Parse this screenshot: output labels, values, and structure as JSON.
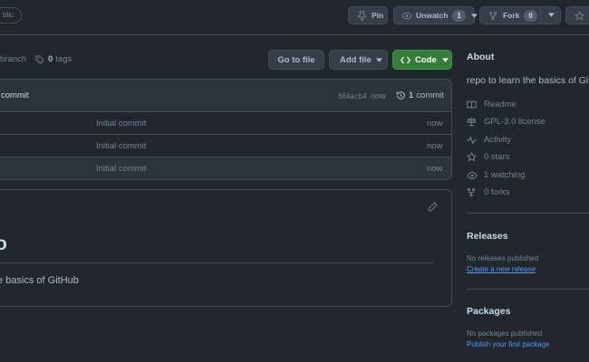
{
  "header": {
    "visibility_badge": "blic",
    "pin_label": "Pin",
    "unwatch_label": "Unwatch",
    "unwatch_count": "1",
    "fork_label": "Fork",
    "fork_count": "0"
  },
  "repo_nav": {
    "branch_label": "branch",
    "tags_count": "0",
    "tags_label": "tags",
    "goto_file_label": "Go to file",
    "add_file_label": "Add file",
    "code_label": "Code"
  },
  "commit_bar": {
    "message": "commit",
    "hash": "664acb4",
    "time": "now",
    "commit_count": "1",
    "commit_label": "commit"
  },
  "files": [
    {
      "message": "Initial commit",
      "time": "now"
    },
    {
      "message": "Initial commit",
      "time": "now"
    },
    {
      "message": "Initial commit",
      "time": "now"
    }
  ],
  "readme": {
    "heading": "o",
    "body": "e basics of GitHub"
  },
  "about": {
    "title": "About",
    "description": "repo to learn the basics of Gi",
    "items": [
      {
        "icon": "book-icon",
        "label": "Readme"
      },
      {
        "icon": "law-scale-icon",
        "label": "GPL-3.0 license"
      },
      {
        "icon": "pulse-icon",
        "label": "Activity"
      },
      {
        "icon": "star-icon",
        "label": "0 stars"
      },
      {
        "icon": "eye-icon",
        "label": "1 watching"
      },
      {
        "icon": "repo-forked-icon",
        "label": "0 forks"
      }
    ]
  },
  "releases": {
    "title": "Releases",
    "empty_text": "No releases published",
    "create_link": "Create a new release"
  },
  "packages": {
    "title": "Packages",
    "empty_text": "No packages published",
    "publish_link": "Publish your first package"
  },
  "colors": {
    "background": "#22272e",
    "border": "#444c56",
    "code_button": "#347d39",
    "link": "#539bf5"
  }
}
